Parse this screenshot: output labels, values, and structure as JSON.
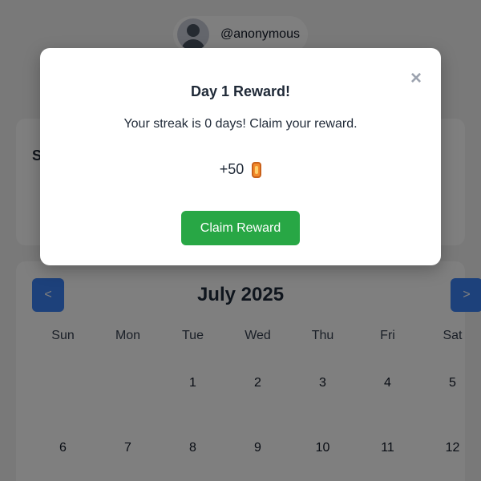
{
  "user": {
    "username": "@anonymous"
  },
  "stats": {
    "heading": "S"
  },
  "calendar": {
    "prev_label": "<",
    "next_label": ">",
    "month_title": "July 2025",
    "weekdays": [
      "Sun",
      "Mon",
      "Tue",
      "Wed",
      "Thu",
      "Fri",
      "Sat"
    ],
    "weeks": [
      [
        "",
        "",
        "1",
        "2",
        "3",
        "4",
        "5"
      ],
      [
        "6",
        "7",
        "8",
        "9",
        "10",
        "11",
        "12"
      ]
    ]
  },
  "modal": {
    "close_label": "×",
    "title": "Day 1 Reward!",
    "message": "Your streak is 0 days! Claim your reward.",
    "reward_amount": "+50",
    "reward_icon": "coin-icon",
    "claim_label": "Claim Reward"
  },
  "colors": {
    "primary_blue": "#3b82f6",
    "claim_green": "#28a745",
    "overlay": "rgba(0,0,0,0.5)",
    "coin": "#f28a2b"
  }
}
